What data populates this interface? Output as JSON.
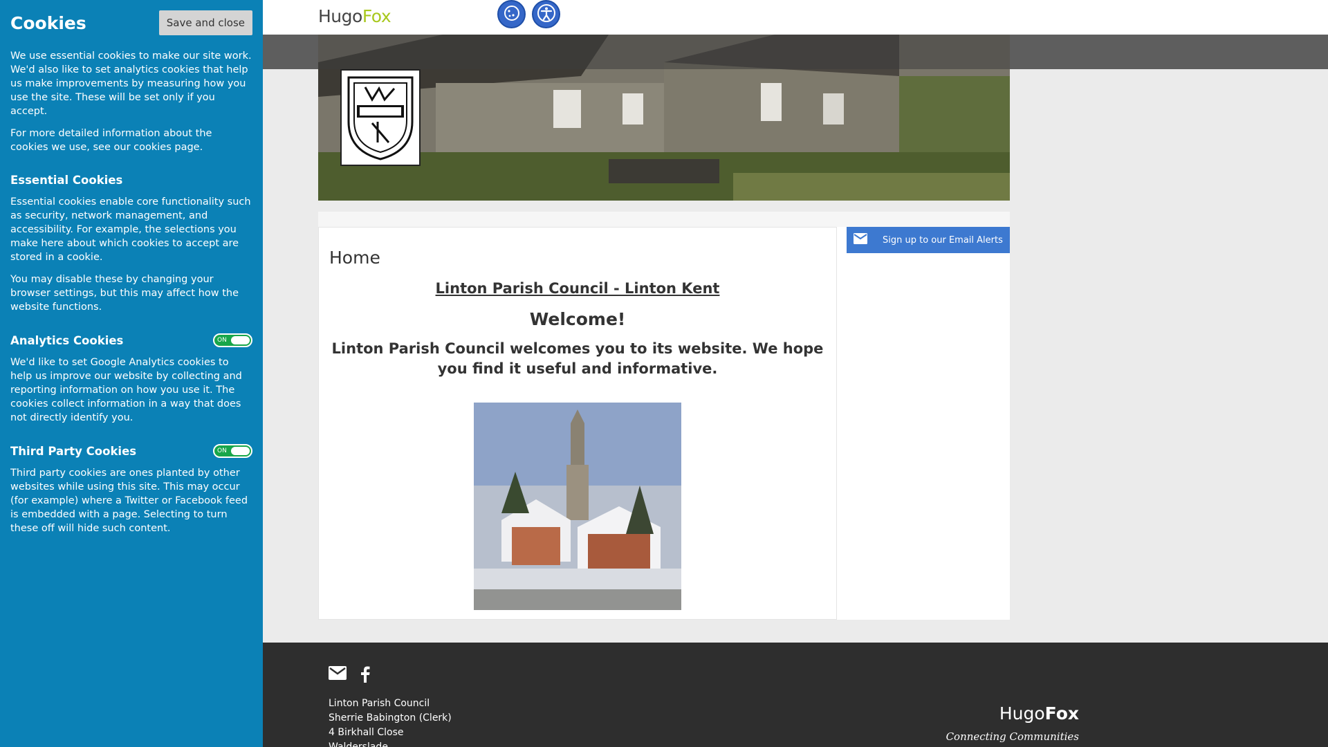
{
  "cookies": {
    "title": "Cookies",
    "save_label": "Save and close",
    "intro1": "We use essential cookies to make our site work. We'd also like to set analytics cookies that help us make improvements by measuring how you use the site. These will be set only if you accept.",
    "intro2": "For more detailed information about the cookies we use, see our cookies page.",
    "essential": {
      "title": "Essential Cookies",
      "text1": "Essential cookies enable core functionality such as security, network management, and accessibility. For example, the selections you make here about which cookies to accept are stored in a cookie.",
      "text2": "You may disable these by changing your browser settings, but this may affect how the website functions."
    },
    "analytics": {
      "title": "Analytics Cookies",
      "toggle": "ON",
      "text": "We'd like to set Google Analytics cookies to help us improve our website by collecting and reporting information on how you use it. The cookies collect information in a way that does not directly identify you."
    },
    "third_party": {
      "title": "Third Party Cookies",
      "toggle": "ON",
      "text": "Third party cookies are ones planted by other websites while using this site. This may occur (for example) where a Twitter or Facebook feed is embedded with a page. Selecting to turn these off will hide such content."
    }
  },
  "header": {
    "logo_a": "Hugo",
    "logo_b": "Fox",
    "icons": [
      "cookie-icon",
      "accessibility-icon"
    ]
  },
  "main": {
    "title": "Home",
    "subtitle": "Linton Parish Council - Linton Kent",
    "welcome": "Welcome!",
    "intro": "Linton Parish Council welcomes you to its website. We hope you find it useful and informative."
  },
  "sidebar": {
    "alerts_label": "Sign up to our Email Alerts"
  },
  "footer": {
    "address": [
      "Linton Parish Council",
      "Sherrie Babington (Clerk)",
      "4 Birkhall Close",
      "Walderslade"
    ],
    "logo_a": "Hugo",
    "logo_b": "Fox",
    "tagline": "Connecting Communities"
  }
}
